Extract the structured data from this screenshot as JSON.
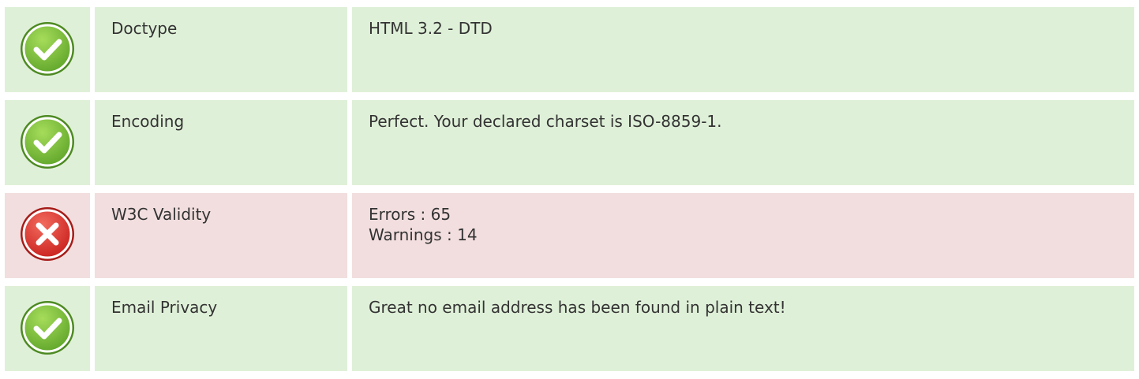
{
  "colors": {
    "ok_bg": "#dff0d8",
    "error_bg": "#f2dede",
    "ok_icon": "#7cc242",
    "error_icon": "#e2302e",
    "text": "#333333"
  },
  "rows": [
    {
      "status": "ok",
      "icon": "check-circle-icon",
      "label": "Doctype",
      "lines": [
        "HTML 3.2 - DTD"
      ]
    },
    {
      "status": "ok",
      "icon": "check-circle-icon",
      "label": "Encoding",
      "lines": [
        "Perfect. Your declared charset is ISO-8859-1."
      ]
    },
    {
      "status": "error",
      "icon": "x-circle-icon",
      "label": "W3C Validity",
      "lines": [
        "Errors : 65",
        "Warnings : 14"
      ]
    },
    {
      "status": "ok",
      "icon": "check-circle-icon",
      "label": "Email Privacy",
      "lines": [
        "Great no email address has been found in plain text!"
      ]
    }
  ]
}
